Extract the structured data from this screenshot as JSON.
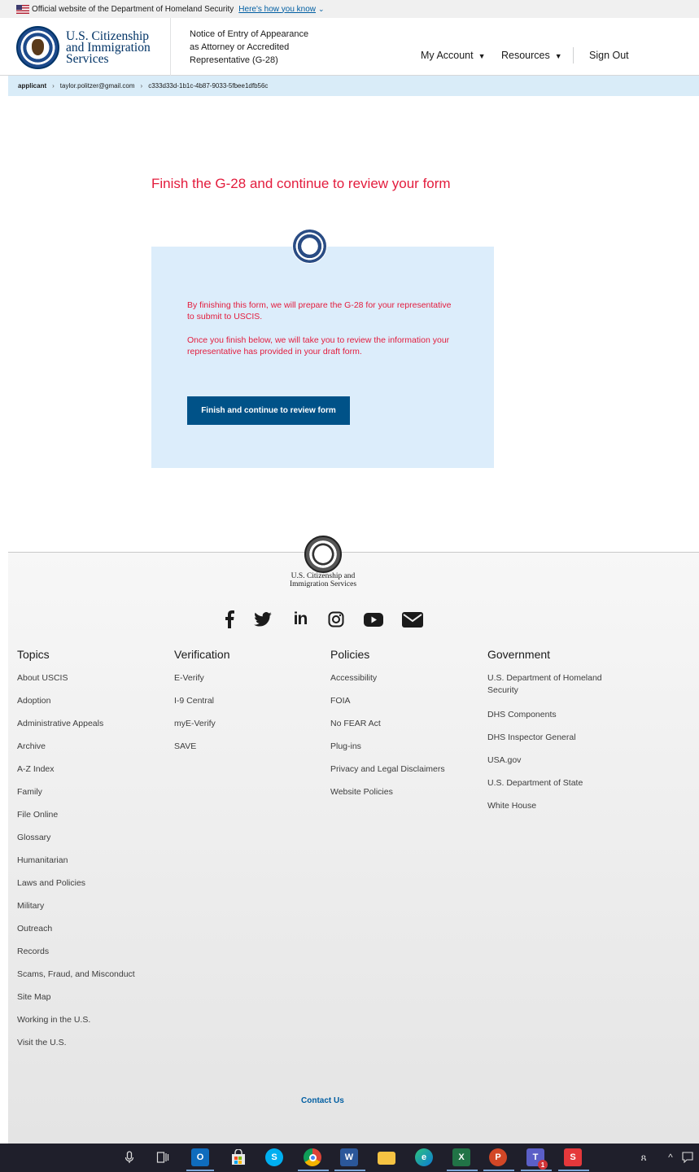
{
  "gov_banner": {
    "official_text": "Official website of the Department of Homeland Security",
    "how_link": "Here's how you know"
  },
  "header": {
    "agency_line1": "U.S. Citizenship",
    "agency_line2": "and Immigration",
    "agency_line3": "Services",
    "form_title_line1": "Notice of Entry of Appearance",
    "form_title_line2": "as Attorney or Accredited",
    "form_title_line3": "Representative (G-28)",
    "nav": {
      "my_account": "My Account",
      "resources": "Resources",
      "sign_out": "Sign Out"
    }
  },
  "breadcrumb": {
    "items": [
      "applicant",
      "taylor.politzer@gmail.com",
      "c333d33d-1b1c-4b87-9033-5fbee1dfb56c"
    ]
  },
  "main": {
    "heading": "Finish the G-28 and continue to review your form",
    "para1": "By finishing this form, we will prepare the G-28 for your representative to submit to USCIS.",
    "para2": "Once you finish below, we will take you to review the information your representative has provided in your draft form.",
    "button_label": "Finish and continue to review form"
  },
  "footer": {
    "agency_line1": "U.S. Citizenship and",
    "agency_line2": "Immigration Services",
    "social_icons": [
      "facebook-icon",
      "twitter-icon",
      "linkedin-icon",
      "instagram-icon",
      "youtube-icon",
      "email-icon"
    ],
    "columns": [
      {
        "heading": "Topics",
        "links": [
          "About USCIS",
          "Adoption",
          "Administrative Appeals",
          "Archive",
          "A-Z Index",
          "Family",
          "File Online",
          "Glossary",
          "Humanitarian",
          "Laws and Policies",
          "Military",
          "Outreach",
          "Records",
          "Scams, Fraud, and Misconduct",
          "Site Map",
          "Working in the U.S.",
          "Visit the U.S."
        ]
      },
      {
        "heading": "Verification",
        "links": [
          "E-Verify",
          "I-9 Central",
          "myE-Verify",
          "SAVE"
        ]
      },
      {
        "heading": "Policies",
        "links": [
          "Accessibility",
          "FOIA",
          "No FEAR Act",
          "Plug-ins",
          "Privacy and Legal Disclaimers",
          "Website Policies"
        ]
      },
      {
        "heading": "Government",
        "links": [
          "U.S. Department of Homeland Security",
          "DHS Components",
          "DHS Inspector General",
          "USA.gov",
          "U.S. Department of State",
          "White House"
        ]
      }
    ],
    "contact": "Contact Us"
  },
  "taskbar": {
    "apps": [
      "microphone-icon",
      "task-view-icon",
      "outlook-icon",
      "store-icon",
      "skype-icon",
      "chrome-icon",
      "word-icon",
      "file-explorer-icon",
      "edge-icon",
      "excel-icon",
      "powerpoint-icon",
      "teams-icon",
      "s-app-icon"
    ],
    "teams_badge": "1"
  }
}
